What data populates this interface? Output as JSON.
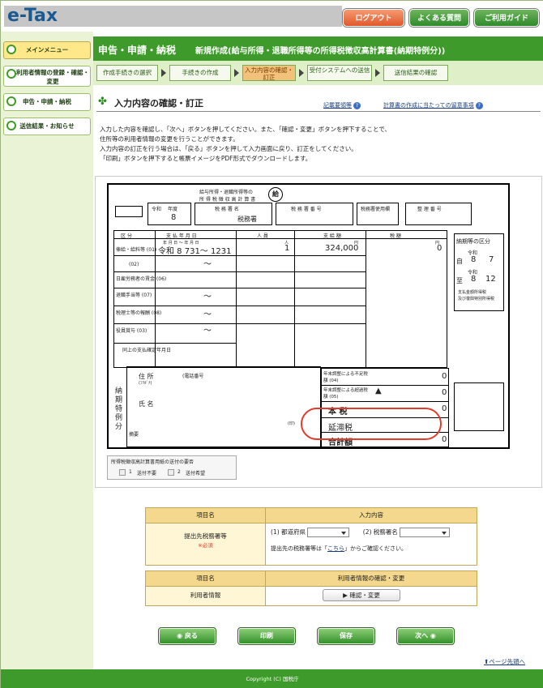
{
  "header": {
    "logo": "e-Tax",
    "login": "ログアウト",
    "faq": "よくある質問",
    "guide": "ご利用ガイド"
  },
  "sidebar": {
    "items": [
      {
        "label": "メインメニュー"
      },
      {
        "label": "利用者情報の登録・確認・変更"
      },
      {
        "label": "申告・申請・納税"
      },
      {
        "label": "送信結果・お知らせ"
      }
    ]
  },
  "title": {
    "main": "申告・申請・納税",
    "sub": "新規作成(給与所得・退職所得等の所得税徴収高計算書(納期特例分))"
  },
  "steps": [
    "作成手続きの選択",
    "手続きの作成",
    "入力内容の確認・訂正",
    "受付システムへの送信",
    "送信結果の確認"
  ],
  "section": {
    "title": "入力内容の確認・訂正",
    "link1": "記載要領等",
    "link2": "計算書の作成に当たっての留意事項"
  },
  "intro": [
    "入力した内容を確認し、「次へ」ボタンを押してください。また、「確認・変更」ボタンを押下することで、",
    "住所等の利用者情報の変更を行うことができます。",
    "入力内容の訂正を行う場合は、「戻る」ボタンを押して入力画面に戻り、訂正をしてください。",
    "「印刷」ボタンを押下すると帳票イメージをPDF形式でダウンロードします。"
  ],
  "form": {
    "title1": "給与所得・退職所得等の",
    "title2": "所 得 税 徴 収 高 計 算 書",
    "stamp": "給",
    "era_label": "令和",
    "year_label": "年度",
    "year": "8",
    "office_label": "税 務 署 名",
    "office": "税務署",
    "office_no_label": "税 務 署 番 号",
    "office_use": "税務署使用欄",
    "ref_no_label": "整 理 番 号",
    "col_kubun": "区 分",
    "col_date": "支 払 年 月 日",
    "col_people": "人 員",
    "col_amount": "支 給 額",
    "col_tax": "税 額",
    "sub_date": "年 月 日 〜 年 月 日",
    "unit_people": "人",
    "unit_yen": "円",
    "row1": "俸給・給料等 (01)",
    "row1_date": "令和 8 731〜 1231",
    "row1_people": "1",
    "row1_amount": "324,000",
    "row1_tax": "0",
    "row2": "(02)",
    "row3": "日雇労務者の賃金 (06)",
    "row4": "退職手当等 (07)",
    "row5": "税理士等の報酬 (08)",
    "row6": "役員賞与 (03)",
    "row7": "同上の支払確定年月日",
    "tilde": "〜",
    "r_nenmatsu1": "年末調整による不足税額 (04)",
    "r_nenmatsu1_v": "0",
    "r_nenmatsu2": "年末調整による超過税額 (05)",
    "r_nenmatsu2_v": "0",
    "triangle": "▲",
    "hon": "本 税",
    "hon_v": "0",
    "entai": "延滞税",
    "total": "合計額",
    "total_v": "0",
    "kubun_title": "納期等の区分",
    "k_era1": "令和",
    "k_from": "自",
    "k_from_y": "8",
    "k_from_m": "7",
    "k_era2": "令和",
    "k_to": "至",
    "k_to_y": "8",
    "k_to_m": "12",
    "k_note1": "支払金額所得税",
    "k_note2": "及び復興特別所得税",
    "left_label": "納期特例分",
    "addr": "住 所",
    "phone": "(電話番号",
    "name": "氏 名",
    "furigana": "(ﾌﾘｶﾞﾅ)",
    "memo": "摘要",
    "name_sub": "(氏 名)",
    "stamp2": "(印)",
    "chk_title": "所得税徴収高計算書用紙の送付の要否",
    "chk1": "1",
    "chk1_l": "送付不要",
    "chk2": "2",
    "chk2_l": "送付希望"
  },
  "table1": {
    "h1": "項目名",
    "h2": "入力内容",
    "label": "提出先税務署等",
    "required": "※必須",
    "pref_label": "(1) 都道府県",
    "office_label": "(2) 税務署名",
    "note_pre": "提出先の税務署等は「",
    "note_link": "こちら",
    "note_post": "」からご確認ください。"
  },
  "table2": {
    "h1": "項目名",
    "h2": "利用者情報の確認・変更",
    "label": "利用者情報",
    "btn": "確認・変更"
  },
  "buttons": {
    "back": "戻る",
    "print": "印刷",
    "save": "保存",
    "next": "次へ"
  },
  "pagetop": "ページ先頭へ",
  "footer": "Copyright (C) 国税庁",
  "colors": {
    "green": "#3e9a2b",
    "orange": "#e0582b",
    "highlight": "#e23b2b"
  }
}
